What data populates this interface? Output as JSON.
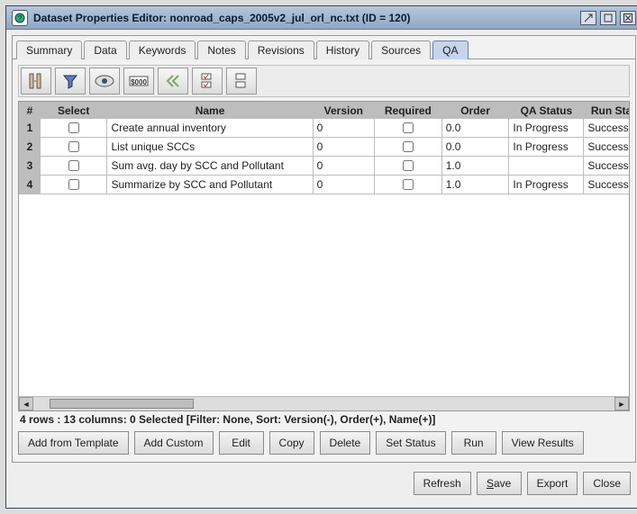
{
  "window": {
    "title": "Dataset Properties Editor: nonroad_caps_2005v2_jul_orl_nc.txt (ID = 120)"
  },
  "tabs": [
    {
      "label": "Summary"
    },
    {
      "label": "Data"
    },
    {
      "label": "Keywords"
    },
    {
      "label": "Notes"
    },
    {
      "label": "Revisions"
    },
    {
      "label": "History"
    },
    {
      "label": "Sources"
    },
    {
      "label": "QA"
    }
  ],
  "active_tab": 7,
  "toolbar_icons": [
    {
      "name": "columns-icon"
    },
    {
      "name": "filter-icon"
    },
    {
      "name": "eye-icon"
    },
    {
      "name": "format-icon"
    },
    {
      "name": "first-page-icon"
    },
    {
      "name": "checklist-icon"
    },
    {
      "name": "uncheck-icon"
    }
  ],
  "grid": {
    "headers": {
      "row_num": "#",
      "select": "Select",
      "name": "Name",
      "version": "Version",
      "required": "Required",
      "order": "Order",
      "qa_status": "QA Status",
      "run_status": "Run Statu"
    },
    "rows": [
      {
        "n": "1",
        "name": "Create annual inventory",
        "version": "0",
        "order": "0.0",
        "qa_status": "In Progress",
        "run_status": "Success"
      },
      {
        "n": "2",
        "name": "List unique SCCs",
        "version": "0",
        "order": "0.0",
        "qa_status": "In Progress",
        "run_status": "Success"
      },
      {
        "n": "3",
        "name": "Sum avg. day by SCC and Pollutant",
        "version": "0",
        "order": "1.0",
        "qa_status": "",
        "run_status": "Success"
      },
      {
        "n": "4",
        "name": "Summarize by SCC and Pollutant",
        "version": "0",
        "order": "1.0",
        "qa_status": "In Progress",
        "run_status": "Success"
      }
    ]
  },
  "status_line": "4 rows : 13 columns: 0 Selected [Filter: None, Sort: Version(-), Order(+), Name(+)]",
  "qa_buttons": [
    {
      "label": "Add from Template"
    },
    {
      "label": "Add Custom"
    },
    {
      "label": "Edit"
    },
    {
      "label": "Copy"
    },
    {
      "label": "Delete"
    },
    {
      "label": "Set Status"
    },
    {
      "label": "Run"
    },
    {
      "label": "View Results"
    }
  ],
  "footer_buttons": [
    {
      "label": "Refresh",
      "mn": ""
    },
    {
      "label": "Save",
      "mn": "S"
    },
    {
      "label": "Export",
      "mn": ""
    },
    {
      "label": "Close",
      "mn": ""
    }
  ]
}
